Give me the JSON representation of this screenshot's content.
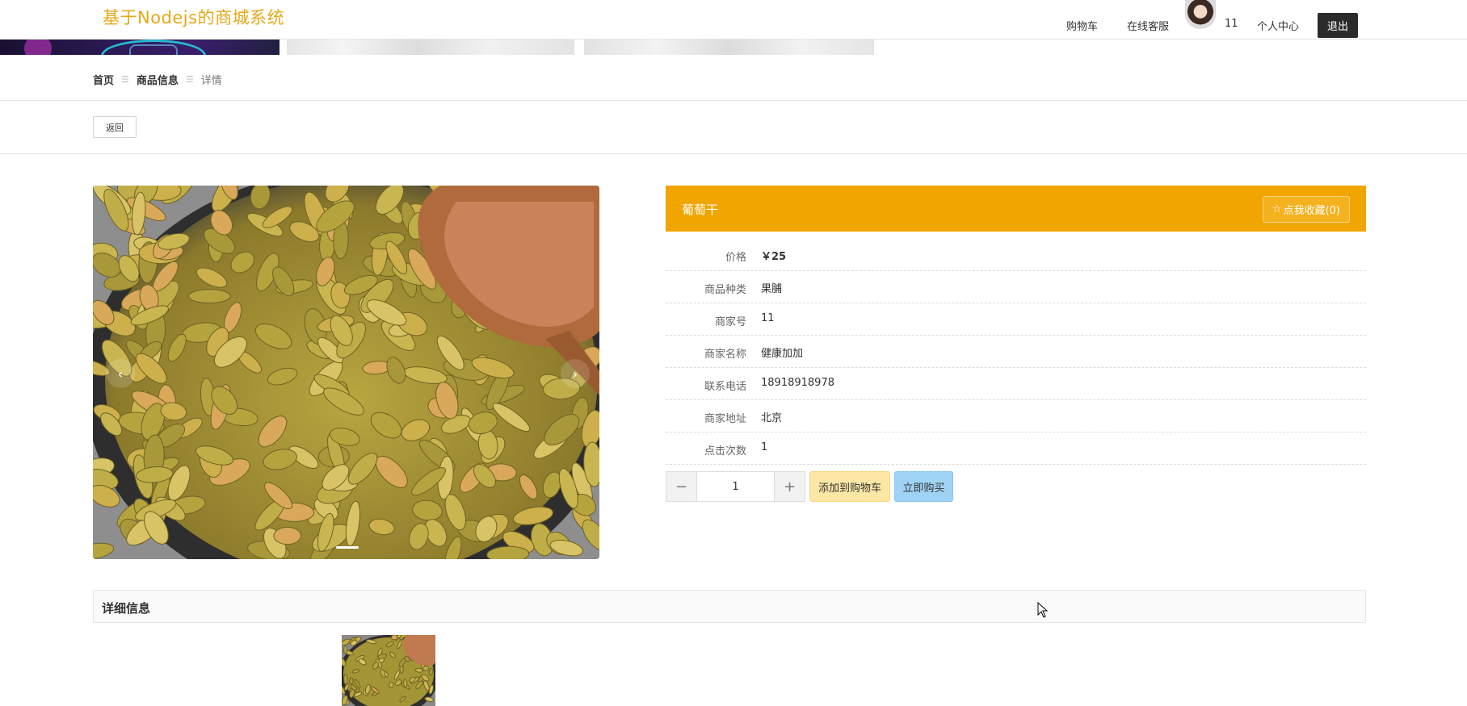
{
  "header": {
    "brand": "基于Nodejs的商城系统",
    "nav": {
      "cart": "购物车",
      "service": "在线客服",
      "username": "11",
      "profile": "个人中心",
      "logout": "退出"
    }
  },
  "breadcrumb": {
    "home": "首页",
    "category": "商品信息",
    "current": "详情"
  },
  "back_label": "返回",
  "carousel": {
    "prev": "‹",
    "next": "›"
  },
  "product": {
    "name": "葡萄干",
    "favorite_label": "点我收藏(0)",
    "fields": [
      {
        "key": "价格",
        "value": "￥25"
      },
      {
        "key": "商品种类",
        "value": "果脯"
      },
      {
        "key": "商家号",
        "value": "11"
      },
      {
        "key": "商家名称",
        "value": "健康加加"
      },
      {
        "key": "联系电话",
        "value": "18918918978"
      },
      {
        "key": "商家地址",
        "value": "北京"
      },
      {
        "key": "点击次数",
        "value": "1"
      }
    ],
    "quantity": "1",
    "minus": "−",
    "plus": "+",
    "add_to_cart": "添加到购物车",
    "buy_now": "立即购买"
  },
  "details": {
    "title": "详细信息"
  },
  "colors": {
    "brand": "#e6a817",
    "accent": "#f0a500",
    "cart_button": "#fde7a6",
    "buy_button": "#9fd3f6"
  }
}
